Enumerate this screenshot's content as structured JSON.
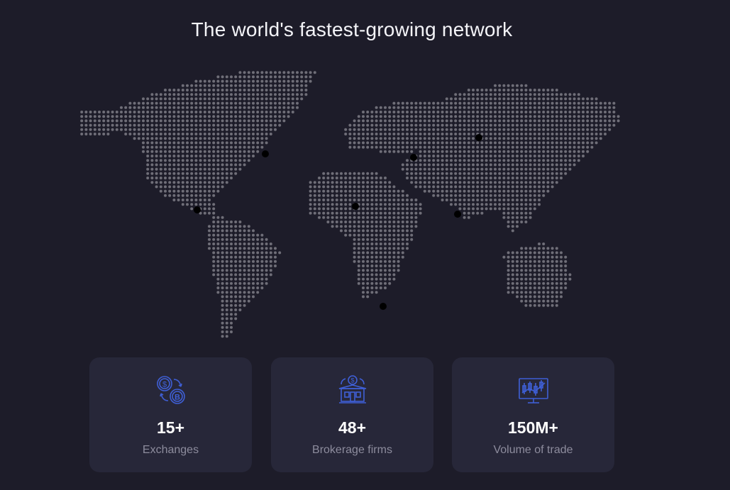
{
  "heading": "The world's fastest-growing network",
  "stats": [
    {
      "value": "15+",
      "label": "Exchanges",
      "icon": "exchange-coins-icon"
    },
    {
      "value": "48+",
      "label": "Brokerage firms",
      "icon": "brokerage-building-icon"
    },
    {
      "value": "150M+",
      "label": "Volume of trade",
      "icon": "trading-chart-monitor-icon"
    }
  ],
  "colors": {
    "background": "#1d1c29",
    "card": "#272739",
    "map_dot": "#6f6e78",
    "marker": "#000000",
    "icon_accent": "#3f5fd6",
    "label": "#8d8c9d"
  }
}
